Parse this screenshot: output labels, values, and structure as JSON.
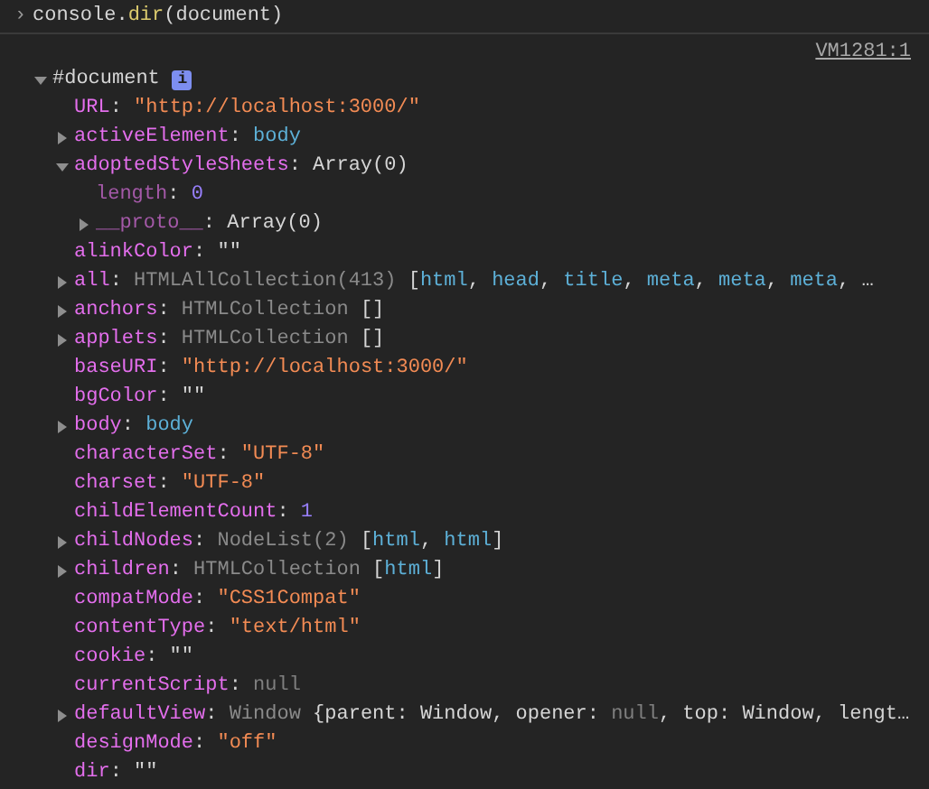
{
  "prompt": {
    "symbol": "›",
    "segments": [
      {
        "text": "console.",
        "kind": "plain"
      },
      {
        "text": "dir",
        "kind": "method"
      },
      {
        "text": "(document)",
        "kind": "plain"
      }
    ]
  },
  "source_link": "VM1281:1",
  "tree": {
    "kind": "expandable",
    "expanded": true,
    "segments": [
      {
        "text": "#document",
        "kind": "plain"
      }
    ],
    "badge": "i",
    "children": [
      {
        "kind": "leaf",
        "segments": [
          {
            "text": "URL",
            "kind": "key"
          },
          {
            "text": ": ",
            "kind": "punct"
          },
          {
            "text": "\"http://localhost:3000/\"",
            "kind": "string"
          }
        ]
      },
      {
        "kind": "expandable",
        "expanded": false,
        "segments": [
          {
            "text": "activeElement",
            "kind": "key"
          },
          {
            "text": ": ",
            "kind": "punct"
          },
          {
            "text": "body",
            "kind": "element"
          }
        ]
      },
      {
        "kind": "expandable",
        "expanded": true,
        "segments": [
          {
            "text": "adoptedStyleSheets",
            "kind": "key"
          },
          {
            "text": ": Array(0)",
            "kind": "plain"
          }
        ],
        "children": [
          {
            "kind": "leaf",
            "segments": [
              {
                "text": "length",
                "kind": "internal"
              },
              {
                "text": ": ",
                "kind": "punct"
              },
              {
                "text": "0",
                "kind": "number"
              }
            ]
          },
          {
            "kind": "expandable",
            "expanded": false,
            "segments": [
              {
                "text": "__proto__",
                "kind": "internal"
              },
              {
                "text": ": Array(0)",
                "kind": "plain"
              }
            ]
          }
        ]
      },
      {
        "kind": "leaf",
        "segments": [
          {
            "text": "alinkColor",
            "kind": "key"
          },
          {
            "text": ": \"\"",
            "kind": "plain"
          }
        ]
      },
      {
        "kind": "expandable",
        "expanded": false,
        "segments": [
          {
            "text": "all",
            "kind": "key"
          },
          {
            "text": ": ",
            "kind": "punct"
          },
          {
            "text": "HTMLAllCollection(413) ",
            "kind": "class"
          },
          {
            "text": "[",
            "kind": "plain"
          },
          {
            "text": "html",
            "kind": "element"
          },
          {
            "text": ", ",
            "kind": "plain"
          },
          {
            "text": "head",
            "kind": "element"
          },
          {
            "text": ", ",
            "kind": "plain"
          },
          {
            "text": "title",
            "kind": "element"
          },
          {
            "text": ", ",
            "kind": "plain"
          },
          {
            "text": "meta",
            "kind": "element"
          },
          {
            "text": ", ",
            "kind": "plain"
          },
          {
            "text": "meta",
            "kind": "element"
          },
          {
            "text": ", ",
            "kind": "plain"
          },
          {
            "text": "meta",
            "kind": "element"
          },
          {
            "text": ", …",
            "kind": "plain"
          }
        ]
      },
      {
        "kind": "expandable",
        "expanded": false,
        "segments": [
          {
            "text": "anchors",
            "kind": "key"
          },
          {
            "text": ": ",
            "kind": "punct"
          },
          {
            "text": "HTMLCollection ",
            "kind": "class"
          },
          {
            "text": "[]",
            "kind": "plain"
          }
        ]
      },
      {
        "kind": "expandable",
        "expanded": false,
        "segments": [
          {
            "text": "applets",
            "kind": "key"
          },
          {
            "text": ": ",
            "kind": "punct"
          },
          {
            "text": "HTMLCollection ",
            "kind": "class"
          },
          {
            "text": "[]",
            "kind": "plain"
          }
        ]
      },
      {
        "kind": "leaf",
        "segments": [
          {
            "text": "baseURI",
            "kind": "key"
          },
          {
            "text": ": ",
            "kind": "punct"
          },
          {
            "text": "\"http://localhost:3000/\"",
            "kind": "string"
          }
        ]
      },
      {
        "kind": "leaf",
        "segments": [
          {
            "text": "bgColor",
            "kind": "key"
          },
          {
            "text": ": \"\"",
            "kind": "plain"
          }
        ]
      },
      {
        "kind": "expandable",
        "expanded": false,
        "segments": [
          {
            "text": "body",
            "kind": "key"
          },
          {
            "text": ": ",
            "kind": "punct"
          },
          {
            "text": "body",
            "kind": "element"
          }
        ]
      },
      {
        "kind": "leaf",
        "segments": [
          {
            "text": "characterSet",
            "kind": "key"
          },
          {
            "text": ": ",
            "kind": "punct"
          },
          {
            "text": "\"UTF-8\"",
            "kind": "string"
          }
        ]
      },
      {
        "kind": "leaf",
        "segments": [
          {
            "text": "charset",
            "kind": "key"
          },
          {
            "text": ": ",
            "kind": "punct"
          },
          {
            "text": "\"UTF-8\"",
            "kind": "string"
          }
        ]
      },
      {
        "kind": "leaf",
        "segments": [
          {
            "text": "childElementCount",
            "kind": "key"
          },
          {
            "text": ": ",
            "kind": "punct"
          },
          {
            "text": "1",
            "kind": "number"
          }
        ]
      },
      {
        "kind": "expandable",
        "expanded": false,
        "segments": [
          {
            "text": "childNodes",
            "kind": "key"
          },
          {
            "text": ": ",
            "kind": "punct"
          },
          {
            "text": "NodeList(2) ",
            "kind": "class"
          },
          {
            "text": "[",
            "kind": "plain"
          },
          {
            "text": "html",
            "kind": "element"
          },
          {
            "text": ", ",
            "kind": "plain"
          },
          {
            "text": "html",
            "kind": "element"
          },
          {
            "text": "]",
            "kind": "plain"
          }
        ]
      },
      {
        "kind": "expandable",
        "expanded": false,
        "segments": [
          {
            "text": "children",
            "kind": "key"
          },
          {
            "text": ": ",
            "kind": "punct"
          },
          {
            "text": "HTMLCollection ",
            "kind": "class"
          },
          {
            "text": "[",
            "kind": "plain"
          },
          {
            "text": "html",
            "kind": "element"
          },
          {
            "text": "]",
            "kind": "plain"
          }
        ]
      },
      {
        "kind": "leaf",
        "segments": [
          {
            "text": "compatMode",
            "kind": "key"
          },
          {
            "text": ": ",
            "kind": "punct"
          },
          {
            "text": "\"CSS1Compat\"",
            "kind": "string"
          }
        ]
      },
      {
        "kind": "leaf",
        "segments": [
          {
            "text": "contentType",
            "kind": "key"
          },
          {
            "text": ": ",
            "kind": "punct"
          },
          {
            "text": "\"text/html\"",
            "kind": "string"
          }
        ]
      },
      {
        "kind": "leaf",
        "segments": [
          {
            "text": "cookie",
            "kind": "key"
          },
          {
            "text": ": \"\"",
            "kind": "plain"
          }
        ]
      },
      {
        "kind": "leaf",
        "segments": [
          {
            "text": "currentScript",
            "kind": "key"
          },
          {
            "text": ": ",
            "kind": "punct"
          },
          {
            "text": "null",
            "kind": "null"
          }
        ]
      },
      {
        "kind": "expandable",
        "expanded": false,
        "segments": [
          {
            "text": "defaultView",
            "kind": "key"
          },
          {
            "text": ": ",
            "kind": "punct"
          },
          {
            "text": "Window ",
            "kind": "class"
          },
          {
            "text": "{parent: Window, opener: ",
            "kind": "plain"
          },
          {
            "text": "null",
            "kind": "null"
          },
          {
            "text": ", top: Window, lengt…",
            "kind": "plain"
          }
        ]
      },
      {
        "kind": "leaf",
        "segments": [
          {
            "text": "designMode",
            "kind": "key"
          },
          {
            "text": ": ",
            "kind": "punct"
          },
          {
            "text": "\"off\"",
            "kind": "string"
          }
        ]
      },
      {
        "kind": "leaf",
        "segments": [
          {
            "text": "dir",
            "kind": "key"
          },
          {
            "text": ": \"\"",
            "kind": "plain"
          }
        ]
      }
    ]
  }
}
